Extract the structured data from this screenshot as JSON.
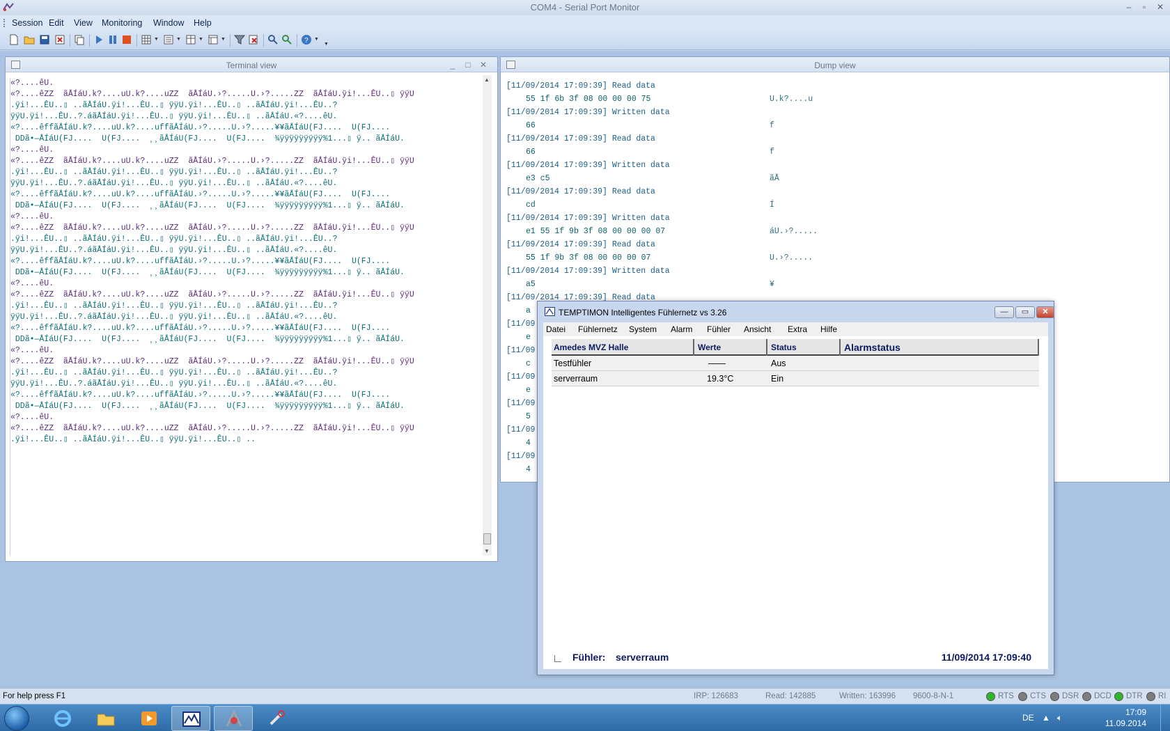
{
  "window": {
    "title": "COM4 - Serial Port Monitor",
    "controls": {
      "minimize": "–",
      "restore": "▫",
      "close": "✕"
    }
  },
  "menu": [
    "Session",
    "Edit",
    "View",
    "Monitoring",
    "Window",
    "Help"
  ],
  "toolbar": {
    "icons": [
      "new-icon",
      "open-icon",
      "save-icon",
      "close-session-icon",
      "copy-icon",
      "play-icon",
      "pause-icon",
      "stop-icon",
      "grid-view-icon",
      "list-view-icon",
      "table-view-icon",
      "layout-icon",
      "filter-icon",
      "clear-filter-icon",
      "find-icon",
      "find-next-icon",
      "help-icon"
    ]
  },
  "terminal": {
    "title": "Terminal view",
    "lines": [
      "«?....êU.",
      "«?....êZZ  ãÅÍáU.k?....uU.k?....uZZ  ãÅÍáU.›?.....U.›?.....ZZ  ãÅÍáU.ÿi!...ÊU..▯ ÿÿU",
      ".ÿi!...ÊU..▯ ..ãÅÍáU.ÿi!...ÊU..▯ ÿÿU.ÿi!...ÊU..▯ ..ãÅÍáU.ÿi!...ÊU..?",
      "ÿÿU.ÿi!...ÊU..?.áãÅÍáU.ÿi!...ÊU..▯ ÿÿU.ÿi!...ÊU..▯ ..ãÅÍáU.«?....êU.",
      "«?....êffãÅÍáU.k?....uU.k?....uffãÅÍáU.›?.....U.›?.....¥¥ãÅÍáU(FJ....  U(FJ....",
      " DDã•—ÅÍáU(FJ....  U(FJ....  ¸¸ãÅÍáU(FJ....  U(FJ....  ¾ÿÿÿÿÿÿÿÿÿ%1...▯ ÿ.. ãÅÍáU.",
      "«?....êU.",
      "«?....êZZ  ãÅÍáU.k?....uU.k?....uZZ  ãÅÍáU.›?.....U.›?.....ZZ  ãÅÍáU.ÿi!...ÊU..▯ ÿÿU",
      ".ÿi!...ÊU..▯ ..ãÅÍáU.ÿi!...ÊU..▯ ÿÿU.ÿi!...ÊU..▯ ..ãÅÍáU.ÿi!...ÊU..?",
      "ÿÿU.ÿi!...ÊU..?.áãÅÍáU.ÿi!...ÊU..▯ ÿÿU.ÿi!...ÊU..▯ ..ãÅÍáU.«?....êU.",
      "«?....êffãÅÍáU.k?....uU.k?....uffãÅÍáU.›?.....U.›?.....¥¥ãÅÍáU(FJ....  U(FJ....",
      " DDã•—ÅÍáU(FJ....  U(FJ....  ¸¸ãÅÍáU(FJ....  U(FJ....  ¾ÿÿÿÿÿÿÿÿÿ%1...▯ ÿ.. ãÅÍáU.",
      "«?....êU.",
      "«?....êZZ  ãÅÍáU.k?....uU.k?....uZZ  ãÅÍáU.›?.....U.›?.....ZZ  ãÅÍáU.ÿi!...ÊU..▯ ÿÿU",
      ".ÿi!...ÊU..▯ ..ãÅÍáU.ÿi!...ÊU..▯ ÿÿU.ÿi!...ÊU..▯ ..ãÅÍáU.ÿi!...ÊU..?",
      "ÿÿU.ÿi!...ÊU..?.áãÅÍáU.ÿi!...ÊU..▯ ÿÿU.ÿi!...ÊU..▯ ..ãÅÍáU.«?....êU.",
      "«?....êffãÅÍáU.k?....uU.k?....uffãÅÍáU.›?.....U.›?.....¥¥ãÅÍáU(FJ....  U(FJ....",
      " DDã•—ÅÍáU(FJ....  U(FJ....  ¸¸ãÅÍáU(FJ....  U(FJ....  ¾ÿÿÿÿÿÿÿÿÿ%1...▯ ÿ.. ãÅÍáU.",
      "«?....êU.",
      "«?....êZZ  ãÅÍáU.k?....uU.k?....uZZ  ãÅÍáU.›?.....U.›?.....ZZ  ãÅÍáU.ÿi!...ÊU..▯ ÿÿU",
      ".ÿi!...ÊU..▯ ..ãÅÍáU.ÿi!...ÊU..▯ ÿÿU.ÿi!...ÊU..▯ ..ãÅÍáU.ÿi!...ÊU..?",
      "ÿÿU.ÿi!...ÊU..?.áãÅÍáU.ÿi!...ÊU..▯ ÿÿU.ÿi!...ÊU..▯ ..ãÅÍáU.«?....êU.",
      "«?....êffãÅÍáU.k?....uU.k?....uffãÅÍáU.›?.....U.›?.....¥¥ãÅÍáU(FJ....  U(FJ....",
      " DDã•—ÅÍáU(FJ....  U(FJ....  ¸¸ãÅÍáU(FJ....  U(FJ....  ¾ÿÿÿÿÿÿÿÿÿ%1...▯ ÿ.. ãÅÍáU.",
      "«?....êU.",
      "«?....êZZ  ãÅÍáU.k?....uU.k?....uZZ  ãÅÍáU.›?.....U.›?.....ZZ  ãÅÍáU.ÿi!...ÊU..▯ ÿÿU",
      ".ÿi!...ÊU..▯ ..ãÅÍáU.ÿi!...ÊU..▯ ÿÿU.ÿi!...ÊU..▯ ..ãÅÍáU.ÿi!...ÊU..?",
      "ÿÿU.ÿi!...ÊU..?.áãÅÍáU.ÿi!...ÊU..▯ ÿÿU.ÿi!...ÊU..▯ ..ãÅÍáU.«?....êU.",
      "«?....êffãÅÍáU.k?....uU.k?....uffãÅÍáU.›?.....U.›?.....¥¥ãÅÍáU(FJ....  U(FJ....",
      " DDã•—ÅÍáU(FJ....  U(FJ....  ¸¸ãÅÍáU(FJ....  U(FJ....  ¾ÿÿÿÿÿÿÿÿÿ%1...▯ ÿ.. ãÅÍáU.",
      "«?....êU.",
      "«?....êZZ  ãÅÍáU.k?....uU.k?....uZZ  ãÅÍáU.›?.....U.›?.....ZZ  ãÅÍáU.ÿi!...ÊU..▯ ÿÿU",
      ".ÿi!...ÊU..▯ ..ãÅÍáU.ÿi!...ÊU..▯ ÿÿU.ÿi!...ÊU..▯ .."
    ],
    "line_colors": [
      "#5b2b7a",
      "#0c6f78"
    ]
  },
  "dump": {
    "title": "Dump view",
    "rows": [
      {
        "ts": "[11/09/2014 17:09:39] Read data"
      },
      {
        "hex": "55 1f 6b 3f 08 00 00 00 75",
        "asc": "U.k?....u"
      },
      {
        "ts": "[11/09/2014 17:09:39] Written data"
      },
      {
        "hex": "66",
        "asc": "f"
      },
      {
        "ts": "[11/09/2014 17:09:39] Read data"
      },
      {
        "hex": "66",
        "asc": "f"
      },
      {
        "ts": "[11/09/2014 17:09:39] Written data"
      },
      {
        "hex": "e3 c5",
        "asc": "ãÅ"
      },
      {
        "ts": "[11/09/2014 17:09:39] Read data"
      },
      {
        "hex": "cd",
        "asc": "Í"
      },
      {
        "ts": "[11/09/2014 17:09:39] Written data"
      },
      {
        "hex": "e1 55 1f 9b 3f 08 00 00 00 07",
        "asc": "áU.›?....."
      },
      {
        "ts": "[11/09/2014 17:09:39] Read data"
      },
      {
        "hex": "55 1f 9b 3f 08 00 00 00 07",
        "asc": "U.›?....."
      },
      {
        "ts": "[11/09/2014 17:09:39] Written data"
      },
      {
        "hex": "a5",
        "asc": "¥"
      },
      {
        "ts": "[11/09/2014 17:09:39] Read data"
      },
      {
        "hex": "a",
        "asc": ""
      },
      {
        "ts": "[11/09"
      },
      {
        "hex": "e",
        "asc": ""
      },
      {
        "ts": "[11/09"
      },
      {
        "hex": "c",
        "asc": ""
      },
      {
        "ts": "[11/09"
      },
      {
        "hex": "e",
        "asc": ""
      },
      {
        "ts": "[11/09"
      },
      {
        "hex": "5",
        "asc": ""
      },
      {
        "ts": "[11/09"
      },
      {
        "hex": "4",
        "asc": ""
      },
      {
        "ts": "[11/09"
      },
      {
        "hex": "4",
        "asc": ""
      }
    ]
  },
  "temptimon": {
    "title": "TEMPTIMON  Intelligentes Fühlernetz  vs 3.26",
    "menu": [
      "Datei",
      "Fühlernetz",
      "System",
      "Alarm",
      "Fühler",
      "Ansicht",
      "Extra",
      "Hilfe"
    ],
    "columns": [
      "Amedes MVZ Halle",
      "Werte",
      "Status",
      "Alarmstatus"
    ],
    "rows": [
      {
        "name": "Testfühler",
        "value": "——",
        "status": "Aus",
        "alarm": ""
      },
      {
        "name": "serverraum",
        "value": "19.3°C",
        "status": "Ein",
        "alarm": ""
      }
    ],
    "footer": {
      "label": "Fühler:",
      "value": "serverraum",
      "datetime": "11/09/2014   17:09:40"
    },
    "buttons": {
      "minimize": "—",
      "maximize": "▭",
      "close": "✕"
    }
  },
  "status": {
    "help": "For help press F1",
    "irp": "IRP: 126683",
    "read": "Read: 142885",
    "written": "Written: 163996",
    "port": "9600-8-N-1",
    "leds": [
      {
        "label": "RTS",
        "color": "#2fb62f"
      },
      {
        "label": "CTS",
        "color": "#7d7d7d"
      },
      {
        "label": "DSR",
        "color": "#7d7d7d"
      },
      {
        "label": "DCD",
        "color": "#7d7d7d"
      },
      {
        "label": "DTR",
        "color": "#2fb62f"
      },
      {
        "label": "RI",
        "color": "#7d7d7d"
      }
    ]
  },
  "taskbar": {
    "apps": [
      "internet-explorer-icon",
      "file-explorer-icon",
      "media-player-icon",
      "temptimon-icon",
      "serial-port-monitor-icon",
      "tools-icon"
    ],
    "language": "DE",
    "time": "17:09",
    "date": "11.09.2014"
  }
}
